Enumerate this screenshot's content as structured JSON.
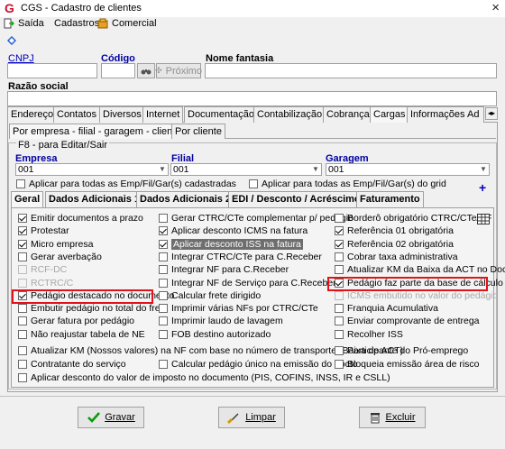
{
  "window": {
    "title": "CGS - Cadastro de clientes",
    "close": "×",
    "logo": "G"
  },
  "menu": {
    "items": [
      {
        "label": "Saída"
      },
      {
        "label": "Cadastros"
      },
      {
        "label": "Comercial"
      }
    ]
  },
  "header": {
    "cnpj_label": "CNPJ",
    "cnpj_value": "",
    "codigo_label": "Código",
    "codigo_value": "",
    "proximo_label": "Próximo",
    "fantasia_label": "Nome fantasia",
    "fantasia_value": "",
    "razao_label": "Razão social",
    "razao_value": ""
  },
  "main_tabs": [
    "Endereço",
    "Contatos",
    "Diversos",
    "Internet",
    "Documentação",
    "Contabilização",
    "Cobrança",
    "Cargas",
    "Informações Ad"
  ],
  "main_tabs_active": "Cargas",
  "sub_tabs": [
    "Por empresa - filial - garagem - cliente",
    "Por cliente"
  ],
  "group": {
    "title": "F8 - para Editar/Sair",
    "empresa_label": "Empresa",
    "empresa_value": "001",
    "filial_label": "Filial",
    "filial_value": "001",
    "garagem_label": "Garagem",
    "garagem_value": "001",
    "check_all_cad": "Aplicar para todas as Emp/Fil/Gar(s) cadastradas",
    "check_all_grid": "Aplicar para todas as Emp/Fil/Gar(s) do grid",
    "plus": "+"
  },
  "inner_tabs": [
    "Geral",
    "Dados Adicionais 1",
    "Dados Adicionais 2",
    "EDI / Desconto / Acréscimo",
    "Faturamento"
  ],
  "col1": [
    {
      "label": "Emitir documentos a prazo",
      "checked": true
    },
    {
      "label": "Protestar",
      "checked": true
    },
    {
      "label": "Micro empresa",
      "checked": true
    },
    {
      "label": "Gerar averbação",
      "checked": false
    },
    {
      "label": "RCF-DC",
      "checked": false,
      "disabled": true
    },
    {
      "label": "RCTRC/C",
      "checked": false,
      "disabled": true
    },
    {
      "label": "Pedágio destacado no documento",
      "checked": true
    },
    {
      "label": "Embutir pedágio no total do frete",
      "checked": false
    },
    {
      "label": "Gerar fatura por pedágio",
      "checked": false
    },
    {
      "label": "Não reajustar tabela de NE",
      "checked": false
    }
  ],
  "col2": [
    {
      "label": "Gerar CTRC/CTe complementar p/ pedágio",
      "checked": false
    },
    {
      "label": "Aplicar desconto ICMS na fatura",
      "checked": true
    },
    {
      "label": "Aplicar desconto ISS na fatura",
      "checked": true,
      "highlight": true
    },
    {
      "label": "Integrar CTRC/CTe para C.Receber",
      "checked": false
    },
    {
      "label": "Integrar NF para C.Receber",
      "checked": false
    },
    {
      "label": "Integrar NF de Serviço para C.Receber",
      "checked": false
    },
    {
      "label": "Calcular frete dirigido",
      "checked": false
    },
    {
      "label": "Imprimir várias NFs por CTRC/CTe",
      "checked": false
    },
    {
      "label": "Imprimir laudo de lavagem",
      "checked": false
    },
    {
      "label": "FOB destino autorizado",
      "checked": false
    }
  ],
  "col3": [
    {
      "label": "Borderô obrigatório CTRC/CTe/NF",
      "checked": false
    },
    {
      "label": "Referência 01 obrigatória",
      "checked": true
    },
    {
      "label": "Referência 02 obrigatória",
      "checked": true
    },
    {
      "label": "Cobrar taxa administrativa",
      "checked": false
    },
    {
      "label": "Atualizar KM da Baixa da ACT no Docto",
      "checked": false
    },
    {
      "label": "Pedágio faz parte da base de cálculo",
      "checked": true
    },
    {
      "label": "ICMS embutido no valor do pedágio",
      "checked": false,
      "disabled": true
    },
    {
      "label": "Franquia Acumulativa",
      "checked": false
    },
    {
      "label": "Enviar comprovante de entrega",
      "checked": false
    },
    {
      "label": "Recolher ISS",
      "checked": false
    }
  ],
  "wide_rows": [
    {
      "label": "Atualizar KM (Nossos valores) na NF com base no número de transporte (Baixa de ACT)",
      "checked": false
    },
    {
      "label": "Contratante do serviço",
      "checked": false
    },
    {
      "label": "Aplicar desconto do valor de imposto no documento (PIS, COFINS, INSS, IR e CSLL)",
      "checked": false
    }
  ],
  "wide_right": [
    {
      "label": "Participante do Pró-emprego",
      "checked": false
    },
    {
      "label": "Bloqueia emissão área de risco",
      "checked": false
    }
  ],
  "wide_mid": {
    "label": "Calcular pedágio único na emissão do docto",
    "checked": false
  },
  "buttons": {
    "gravar": "Gravar",
    "limpar": "Limpar",
    "excluir": "Excluir"
  },
  "colors": {
    "accent": "#0000a0",
    "highlight_border": "#e0131a"
  }
}
